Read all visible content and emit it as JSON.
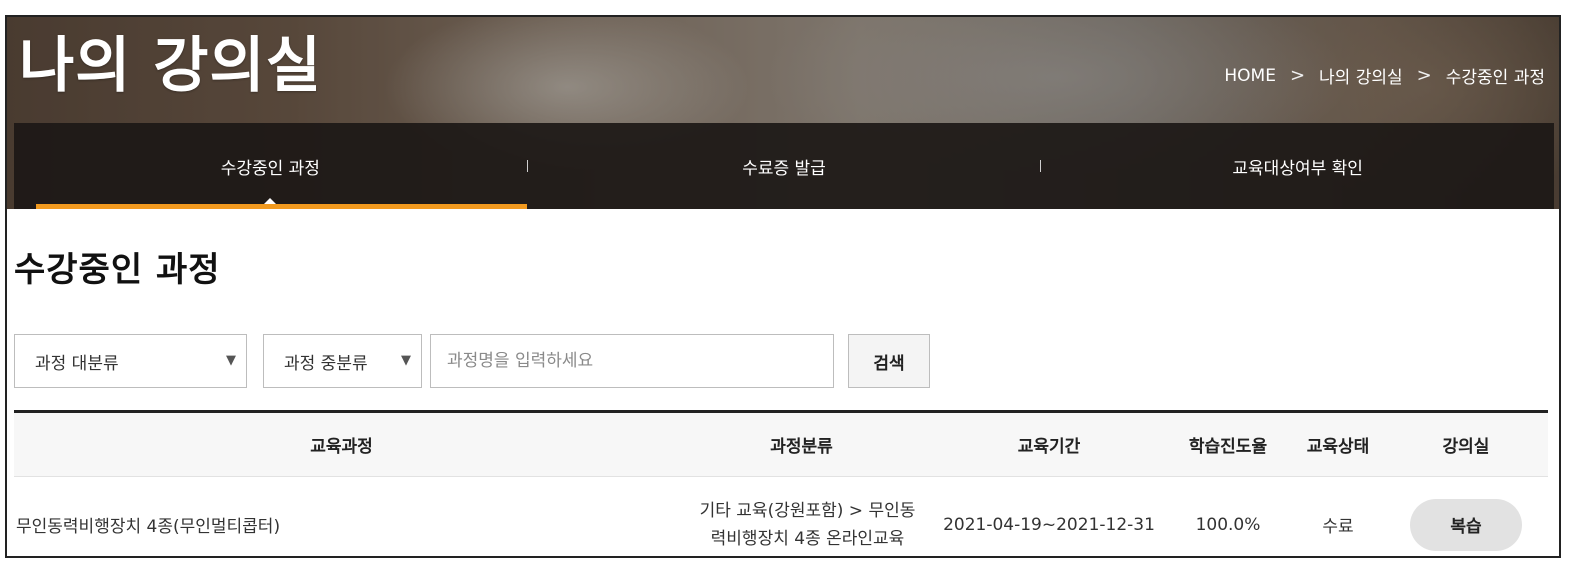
{
  "hero": {
    "title": "나의 강의실"
  },
  "breadcrumb": {
    "items": [
      "HOME",
      "나의 강의실",
      "수강중인 과정"
    ],
    "separator": ">"
  },
  "tabs": [
    {
      "label": "수강중인 과정",
      "active": true
    },
    {
      "label": "수료증 발급",
      "active": false
    },
    {
      "label": "교육대상여부 확인",
      "active": false
    }
  ],
  "page": {
    "heading": "수강중인 과정"
  },
  "filters": {
    "category_major": {
      "value": "과정 대분류"
    },
    "category_minor": {
      "value": "과정 중분류"
    },
    "search": {
      "placeholder": "과정명을 입력하세요",
      "button_label": "검색"
    }
  },
  "table": {
    "headers": [
      "교육과정",
      "과정분류",
      "교육기간",
      "학습진도율",
      "교육상태",
      "강의실"
    ],
    "rows": [
      {
        "course": "무인동력비행장치 4종(무인멀티콥터)",
        "category_line1": "기타 교육(강원포함) > 무인동",
        "category_line2": "력비행장치 4종 온라인교육",
        "period": "2021-04-19~2021-12-31",
        "progress": "100.0%",
        "status": "수료",
        "action_label": "복습"
      }
    ]
  },
  "colors": {
    "accent": "#f29a1f",
    "tabbar": "#1c1816",
    "header_bg": "#f7f7f7"
  }
}
